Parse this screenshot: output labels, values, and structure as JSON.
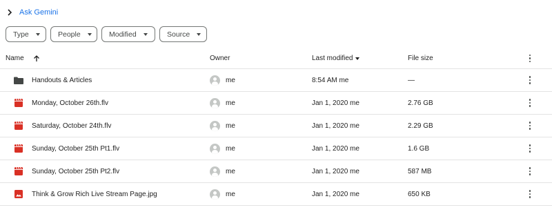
{
  "gemini": {
    "label": "Ask Gemini"
  },
  "filters": [
    {
      "label": "Type"
    },
    {
      "label": "People"
    },
    {
      "label": "Modified"
    },
    {
      "label": "Source"
    }
  ],
  "columns": {
    "name": "Name",
    "owner": "Owner",
    "modified": "Last modified",
    "size": "File size"
  },
  "rows": [
    {
      "name": "Handouts & Articles",
      "icon": "folder-icon",
      "owner": "me",
      "modified": "8:54 AM me",
      "size": "—"
    },
    {
      "name": "Monday, October 26th.flv",
      "icon": "video-icon",
      "owner": "me",
      "modified": "Jan 1, 2020 me",
      "size": "2.76 GB"
    },
    {
      "name": "Saturday, October 24th.flv",
      "icon": "video-icon",
      "owner": "me",
      "modified": "Jan 1, 2020 me",
      "size": "2.29 GB"
    },
    {
      "name": "Sunday, October 25th Pt1.flv",
      "icon": "video-icon",
      "owner": "me",
      "modified": "Jan 1, 2020 me",
      "size": "1.6 GB"
    },
    {
      "name": "Sunday, October 25th Pt2.flv",
      "icon": "video-icon",
      "owner": "me",
      "modified": "Jan 1, 2020 me",
      "size": "587 MB"
    },
    {
      "name": "Think & Grow Rich Live Stream Page.jpg",
      "icon": "image-icon",
      "owner": "me",
      "modified": "Jan 1, 2020 me",
      "size": "650 KB"
    }
  ],
  "colors": {
    "accent": "#1a73e8",
    "video": "#d93025",
    "image": "#d93025",
    "folder": "#444746"
  }
}
